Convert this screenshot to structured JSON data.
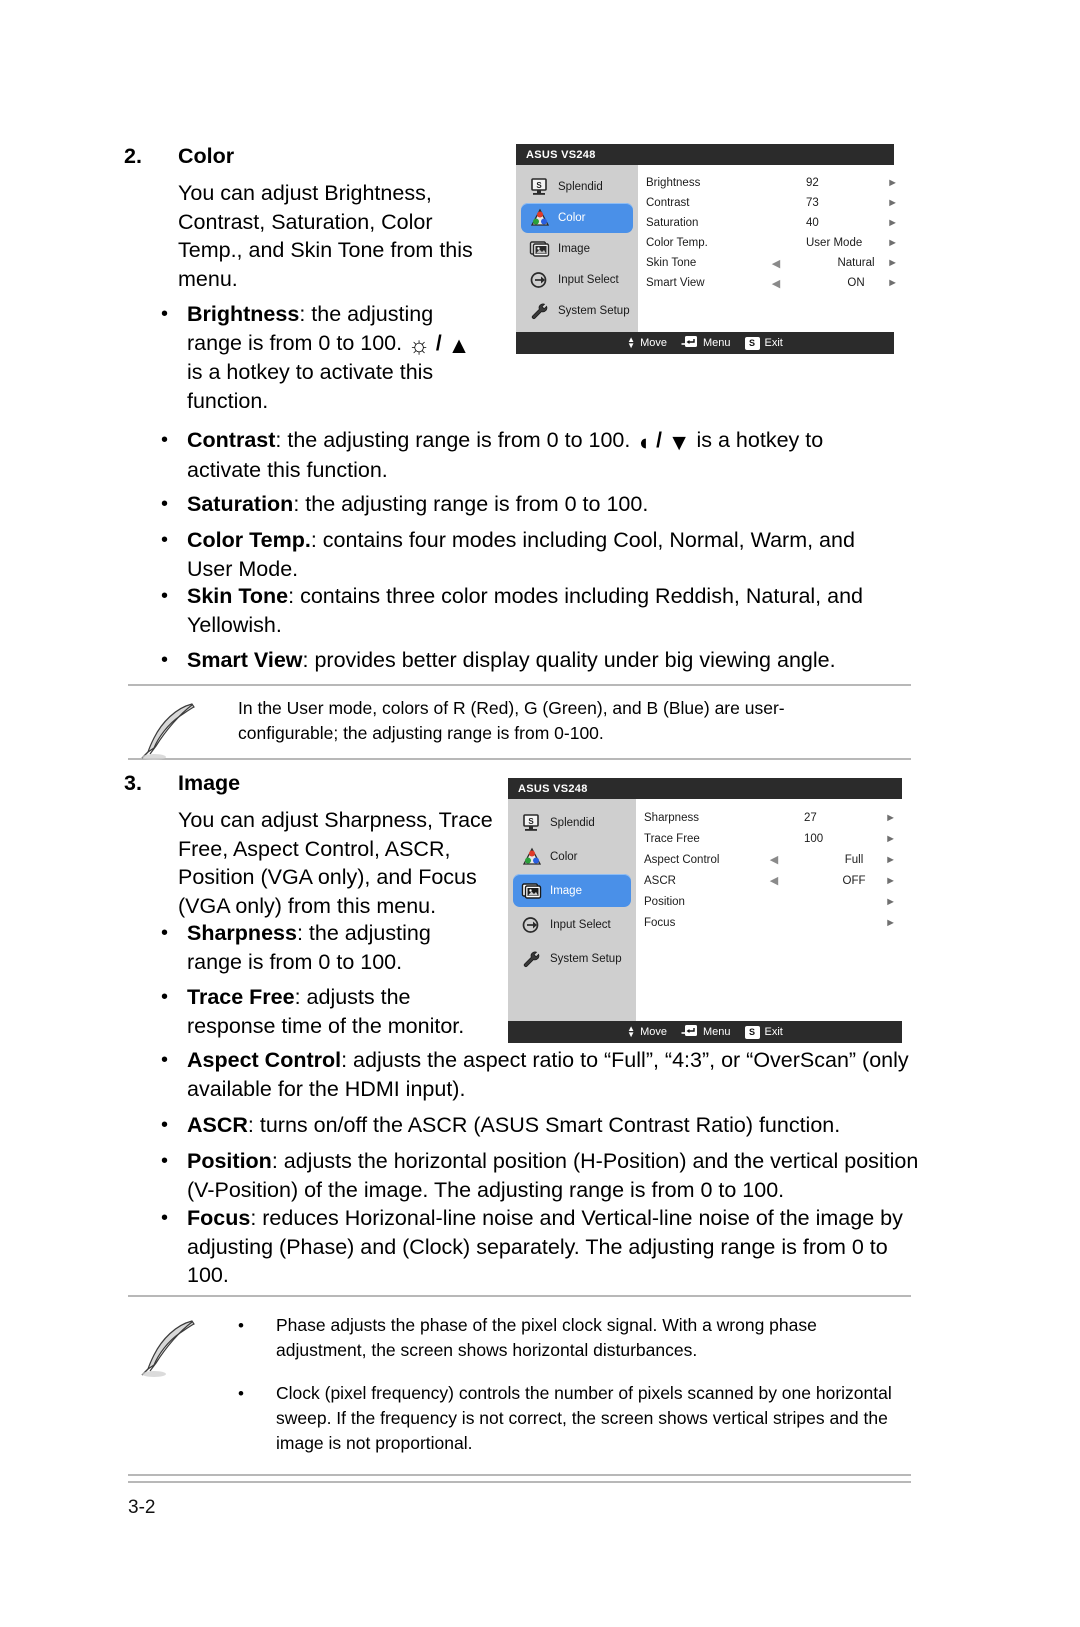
{
  "document": {
    "page_number": "3-2"
  },
  "section_color": {
    "number": "2.",
    "title": "Color",
    "intro": "You can adjust Brightness, Contrast, Saturation, Color Temp., and Skin Tone from this menu.",
    "bullets": [
      {
        "term": "Brightness",
        "text_before": ": the adjusting range is from 0 to 100. ",
        "glyph": "sun-slash-up-arrow",
        "text_after": " is a hotkey to activate this function."
      },
      {
        "term": "Contrast",
        "text_before": ": the adjusting range is from 0 to 100. ",
        "glyph": "half-circle-slash-down-arrow",
        "text_after": " is a hotkey to activate this function."
      },
      {
        "term": "Saturation",
        "text_before": ": the adjusting range is from 0 to 100.",
        "glyph": "",
        "text_after": ""
      },
      {
        "term": "Color Temp.",
        "text_before": ": contains four modes including Cool, Normal, Warm, and User Mode.",
        "glyph": "",
        "text_after": ""
      },
      {
        "term": "Skin Tone",
        "text_before": ": contains three color modes including Reddish, Natural, and Yellowish.",
        "glyph": "",
        "text_after": ""
      },
      {
        "term": "Smart View",
        "text_before": ": provides better display quality under big viewing angle.",
        "glyph": "",
        "text_after": ""
      }
    ]
  },
  "note_color": {
    "lines": [
      "In the User mode, colors of R (Red), G (Green), and B (Blue) are user-",
      "configurable; the adjusting range is from 0-100."
    ]
  },
  "section_image": {
    "number": "3.",
    "title": "Image",
    "intro": "You can adjust Sharpness, Trace Free, Aspect Control, ASCR, Position (VGA only), and Focus (VGA only) from this menu.",
    "bullets": [
      {
        "term": "Sharpness",
        "text": ": the adjusting range is from 0 to 100."
      },
      {
        "term": "Trace Free",
        "text": ": adjusts the response time of the monitor."
      },
      {
        "term": "Aspect Control",
        "text": ": adjusts the aspect ratio to “Full”, “4:3”, or “OverScan” (only available for the HDMI input)."
      },
      {
        "term": "ASCR",
        "text": ": turns on/off the ASCR (ASUS Smart Contrast Ratio) function."
      },
      {
        "term": "Position",
        "text": ": adjusts the horizontal position (H-Position) and the vertical position (V-Position) of the image. The adjusting range is from 0 to 100."
      },
      {
        "term": "Focus",
        "text": ": reduces Horizonal-line noise and Vertical-line noise of the image by adjusting (Phase) and (Clock) separately. The adjusting range is from 0 to 100."
      }
    ]
  },
  "note_image": {
    "bullets": [
      "Phase adjusts the phase of the pixel clock signal. With a wrong phase adjustment, the screen shows horizontal disturbances.",
      "Clock (pixel frequency) controls the number of pixels scanned by one horizontal sweep. If the frequency is not correct, the screen shows vertical stripes and the image is not proportional."
    ]
  },
  "osd_color": {
    "title": "ASUS VS248",
    "sidebar": [
      {
        "label": "Splendid",
        "icon": "splendid-icon",
        "active": false
      },
      {
        "label": "Color",
        "icon": "color-icon",
        "active": true
      },
      {
        "label": "Image",
        "icon": "image-icon",
        "active": false
      },
      {
        "label": "Input Select",
        "icon": "input-select-icon",
        "active": false
      },
      {
        "label": "System Setup",
        "icon": "wrench-icon",
        "active": false
      }
    ],
    "rows": [
      {
        "label": "Brightness",
        "value": "92",
        "left_arrow": false,
        "right_arrow": true
      },
      {
        "label": "Contrast",
        "value": "73",
        "left_arrow": false,
        "right_arrow": true
      },
      {
        "label": "Saturation",
        "value": "40",
        "left_arrow": false,
        "right_arrow": true
      },
      {
        "label": "Color Temp.",
        "value": "User Mode",
        "left_arrow": false,
        "right_arrow": true
      },
      {
        "label": "Skin Tone",
        "value": "Natural",
        "left_arrow": true,
        "right_arrow": true
      },
      {
        "label": "Smart View",
        "value": "ON",
        "left_arrow": true,
        "right_arrow": true
      }
    ],
    "footer": {
      "move": "Move",
      "menu": "Menu",
      "exit": "Exit",
      "exit_key": "S"
    },
    "accent_color": "#4a90e8"
  },
  "osd_image": {
    "title": "ASUS VS248",
    "sidebar": [
      {
        "label": "Splendid",
        "icon": "splendid-icon",
        "active": false
      },
      {
        "label": "Color",
        "icon": "color-icon",
        "active": false
      },
      {
        "label": "Image",
        "icon": "image-icon",
        "active": true
      },
      {
        "label": "Input Select",
        "icon": "input-select-icon",
        "active": false
      },
      {
        "label": "System Setup",
        "icon": "wrench-icon",
        "active": false
      }
    ],
    "rows": [
      {
        "label": "Sharpness",
        "value": "27",
        "left_arrow": false,
        "right_arrow": true
      },
      {
        "label": "Trace Free",
        "value": "100",
        "left_arrow": false,
        "right_arrow": true
      },
      {
        "label": "Aspect Control",
        "value": "Full",
        "left_arrow": true,
        "right_arrow": true
      },
      {
        "label": "ASCR",
        "value": "OFF",
        "left_arrow": true,
        "right_arrow": true
      },
      {
        "label": "Position",
        "value": "",
        "left_arrow": false,
        "right_arrow": true
      },
      {
        "label": "Focus",
        "value": "",
        "left_arrow": false,
        "right_arrow": true
      }
    ],
    "footer": {
      "move": "Move",
      "menu": "Menu",
      "exit": "Exit",
      "exit_key": "S"
    },
    "accent_color": "#4a90e8"
  }
}
